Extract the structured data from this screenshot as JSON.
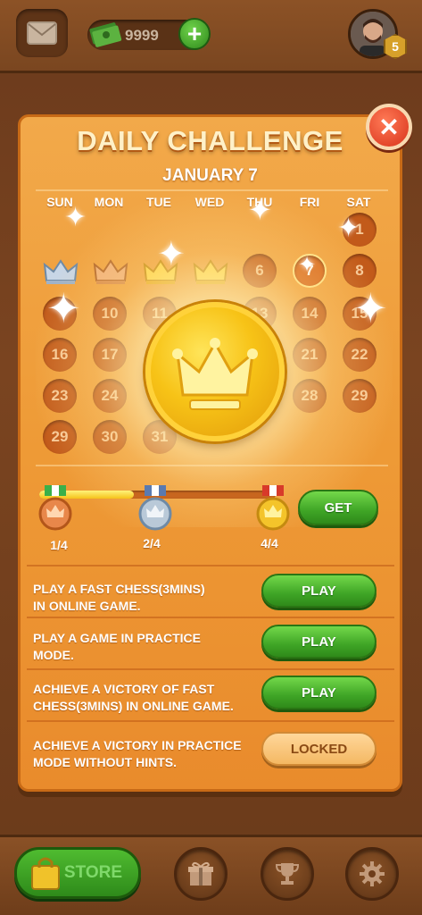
{
  "top_bar": {
    "cash_amount": "9999",
    "coin_amount": "9999",
    "level": "5"
  },
  "dialog": {
    "title": "DAILY CHALLENGE",
    "date": "JANUARY 7",
    "weekdays": [
      "SUN",
      "MON",
      "TUE",
      "WED",
      "THU",
      "FRI",
      "SAT"
    ],
    "days": {
      "d1": "1",
      "d6": "6",
      "d7": "7",
      "d8": "8",
      "d10": "10",
      "d11": "11",
      "d13": "13",
      "d14": "14",
      "d15": "15",
      "d16": "16",
      "d17": "17",
      "d21": "21",
      "d22": "22",
      "d23": "23",
      "d24": "24",
      "d28": "28",
      "d29": "29",
      "d29b": "29",
      "d30": "30",
      "d31": "31"
    },
    "progress": {
      "fraction": 0.4,
      "milestones": [
        "1/4",
        "2/4",
        "4/4"
      ],
      "get_label": "GET"
    },
    "tasks": [
      {
        "text_line1": "PLAY A FAST CHESS(3MINS)",
        "text_line2": "IN ONLINE GAME.",
        "button": "PLAY"
      },
      {
        "text_line1": "PLAY A GAME IN PRACTICE",
        "text_line2": "MODE.",
        "button": "PLAY"
      },
      {
        "text_line1": "ACHIEVE A VICTORY OF FAST",
        "text_line2": "CHESS(3MINS) IN ONLINE GAME.",
        "button": "PLAY"
      },
      {
        "text_line1": "ACHIEVE A VICTORY IN PRACTICE",
        "text_line2": "MODE WITHOUT HINTS.",
        "button": "LOCKED"
      }
    ]
  },
  "bottom_bar": {
    "store_label": "STORE",
    "icons": [
      "gift-icon",
      "trophy-icon",
      "gear-icon"
    ]
  },
  "colors": {
    "panel": "#ee9a36",
    "play_green": "#3fa526",
    "close_red": "#d8321a"
  }
}
